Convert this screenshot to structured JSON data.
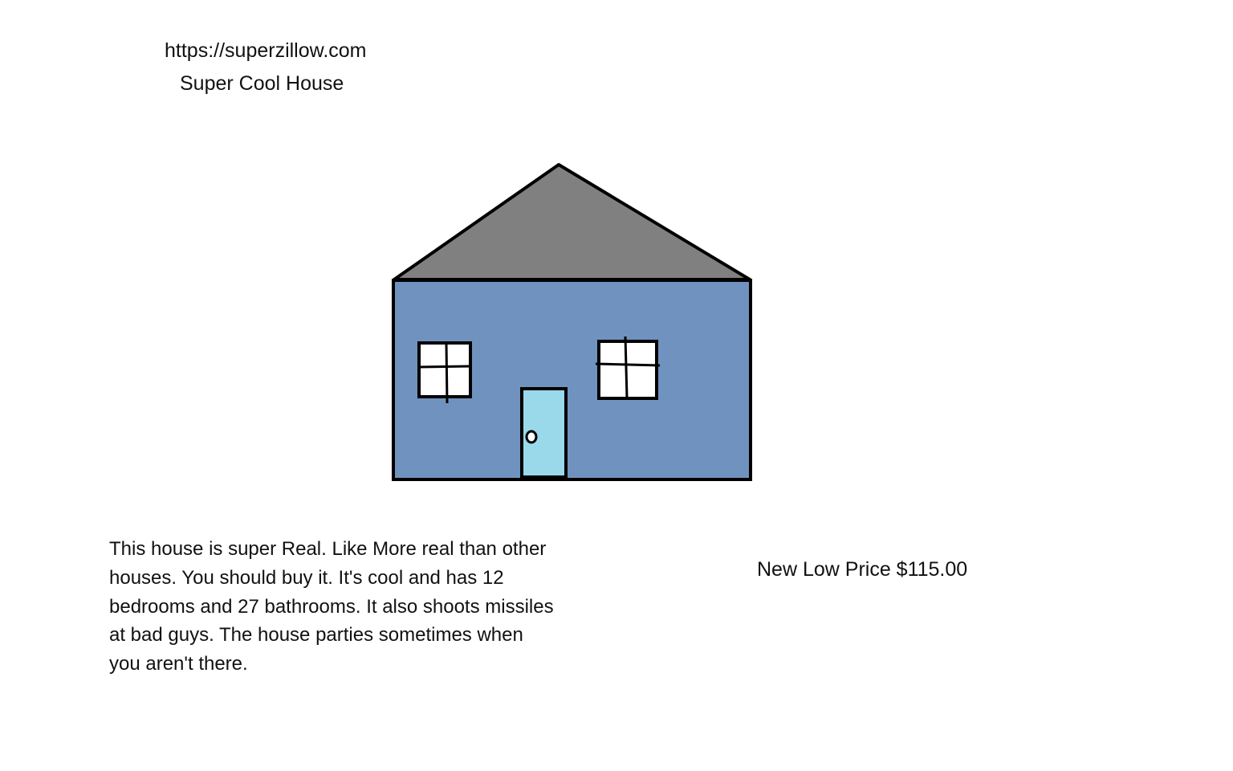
{
  "header": {
    "url": "https://superzillow.com",
    "title": "Super Cool House"
  },
  "listing": {
    "description": "This house is super Real. Like More real than other houses. You should buy it. It's cool and has 12 bedrooms and 27 bathrooms. It also shoots missiles at bad guys. The house parties sometimes when you aren't there.",
    "price": "New Low Price $115.00"
  },
  "house_colors": {
    "roof": "#808080",
    "wall": "#7092be",
    "door": "#99d9ea",
    "window": "#ffffff",
    "outline": "#000000"
  }
}
